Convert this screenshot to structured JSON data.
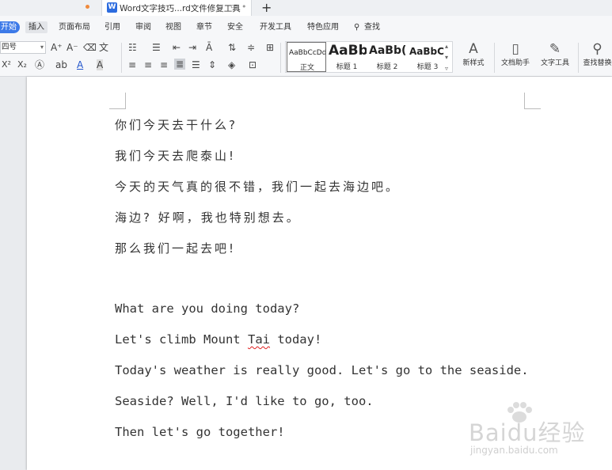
{
  "tabs": {
    "doc_title": "Word文字技巧...rd文件修复工具",
    "app_icon_letter": "W",
    "new_tab": "+"
  },
  "menu": {
    "start": "开始",
    "insert": "插入",
    "page_layout": "页面布局",
    "references": "引用",
    "review": "审阅",
    "view": "视图",
    "sections": "章节",
    "security": "安全",
    "developer": "开发工具",
    "special": "特色应用",
    "find": "查找"
  },
  "ribbon": {
    "font_size": "四号",
    "styles": [
      {
        "sample": "AaBbCcDd",
        "caption": "正文"
      },
      {
        "sample": "AaBb",
        "caption": "标题 1"
      },
      {
        "sample": "AaBb(",
        "caption": "标题 2"
      },
      {
        "sample": "AaBbC",
        "caption": "标题 3"
      }
    ],
    "new_style": "新样式",
    "doc_assistant": "文档助手",
    "text_tools": "文字工具",
    "find_replace": "查找替换"
  },
  "document": {
    "chinese_lines": [
      "你们今天去干什么?",
      "我们今天去爬泰山!",
      "今天的天气真的很不错，我们一起去海边吧。",
      "海边? 好啊，我也特别想去。",
      "那么我们一起去吧!"
    ],
    "english_lines": [
      "What are you doing today?",
      "Let's climb Mount ",
      "Today's weather is really good. Let's go to the seaside.",
      "Seaside? Well, I'd like to go, too.",
      "Then let's go together!"
    ],
    "misspelled_word": "Tai",
    "after_misspelled": " today!"
  },
  "watermark": {
    "brand": "Baidu经验",
    "url": "jingyan.baidu.com"
  },
  "colors": {
    "accent": "#3d7ae8",
    "page_bg": "#ffffff",
    "gutter_bg": "#e9ebee",
    "spell_error": "#e02020"
  }
}
